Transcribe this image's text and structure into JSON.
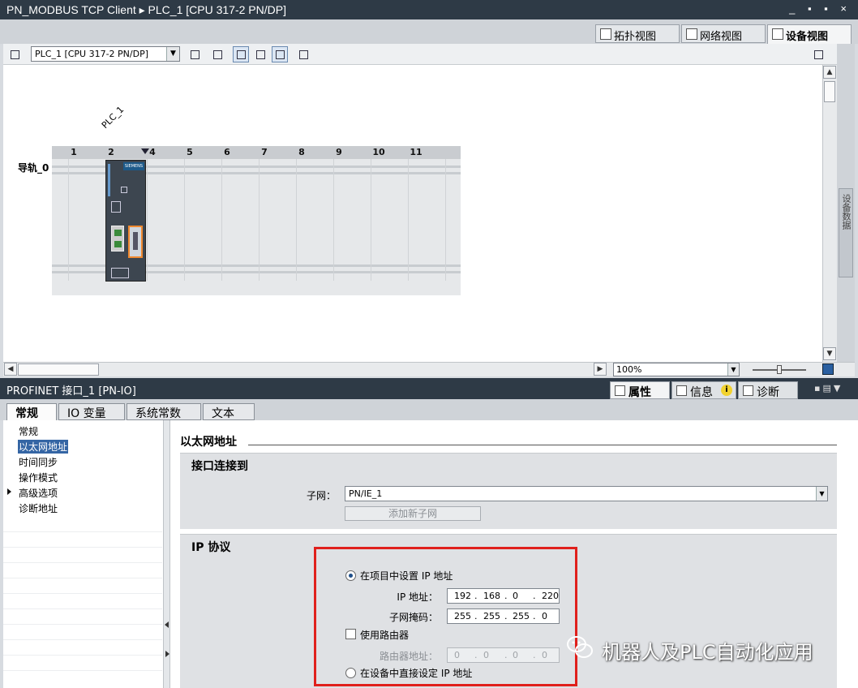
{
  "window": {
    "title": "PN_MODBUS TCP Client  ▸  PLC_1 [CPU 317-2 PN/DP]",
    "controls": "_ ▪ ▪ ×"
  },
  "view_tabs": [
    {
      "label": "拓扑视图",
      "icon": "topology-icon"
    },
    {
      "label": "网络视图",
      "icon": "network-icon"
    },
    {
      "label": "设备视图",
      "icon": "device-icon",
      "active": true
    }
  ],
  "toolbar": {
    "device_select": "PLC_1 [CPU 317-2 PN/DP]"
  },
  "device_view": {
    "plc_label": "PLC_1",
    "rail_label": "导轨_0",
    "slots": [
      "1",
      "2",
      "4",
      "5",
      "6",
      "7",
      "8",
      "9",
      "10",
      "11"
    ],
    "cpu_brand": "SIEMENS",
    "zoom": "100%",
    "side_tab": "设备数据"
  },
  "inspector": {
    "title": "PROFINET 接口_1 [PN-IO]",
    "tabs": [
      {
        "label": "属性",
        "active": true
      },
      {
        "label": "信息"
      },
      {
        "label": "诊断"
      }
    ],
    "subtabs": [
      {
        "label": "常规",
        "active": true
      },
      {
        "label": "IO 变量"
      },
      {
        "label": "系统常数"
      },
      {
        "label": "文本"
      }
    ],
    "nav": [
      "常规",
      "以太网地址",
      "时间同步",
      "操作模式",
      "高级选项",
      "诊断地址"
    ],
    "nav_selected": 1
  },
  "form": {
    "section_title": "以太网地址",
    "interface_group": "接口连接到",
    "subnet_label": "子网：",
    "subnet_value": "PN/IE_1",
    "add_subnet": "添加新子网",
    "ip_group": "IP 协议",
    "set_in_project": "在项目中设置 IP 地址",
    "ip_label": "IP 地址：",
    "ip": [
      "192",
      "168",
      "0",
      "220"
    ],
    "mask_label": "子网掩码：",
    "mask": [
      "255",
      "255",
      "255",
      "0"
    ],
    "use_router": "使用路由器",
    "router_label": "路由器地址：",
    "router": [
      "0",
      "0",
      "0",
      "0"
    ],
    "set_on_device": "在设备中直接设定 IP 地址"
  },
  "watermark": "机器人及PLC自动化应用"
}
